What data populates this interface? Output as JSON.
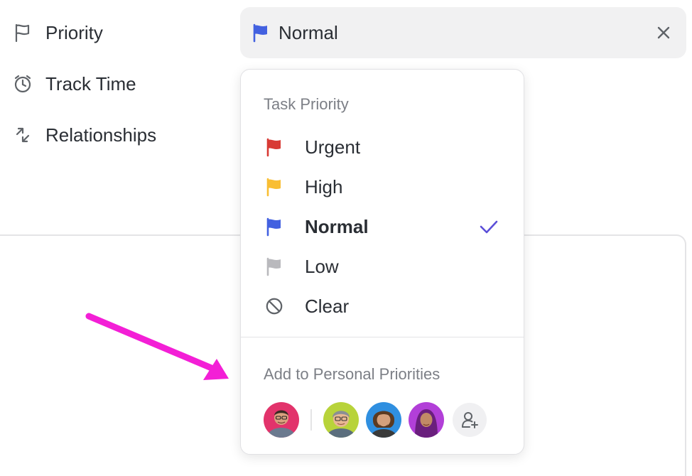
{
  "properties": {
    "priority": {
      "label": "Priority",
      "icon": "flag-outline-icon"
    },
    "track_time": {
      "label": "Track Time",
      "icon": "timer-icon"
    },
    "relationships": {
      "label": "Relationships",
      "icon": "relationships-icon"
    }
  },
  "priority_field": {
    "value": "Normal",
    "flag_color": "#4361e0",
    "clear_icon": "close-icon"
  },
  "dropdown": {
    "title": "Task Priority",
    "options": [
      {
        "label": "Urgent",
        "icon": "flag-icon",
        "color": "#d83a34"
      },
      {
        "label": "High",
        "icon": "flag-icon",
        "color": "#f9be33"
      },
      {
        "label": "Normal",
        "icon": "flag-icon",
        "color": "#4361e0",
        "selected": true
      },
      {
        "label": "Low",
        "icon": "flag-icon",
        "color": "#b9b9bd"
      },
      {
        "label": "Clear",
        "icon": "ban-icon",
        "color": "#5f6368"
      }
    ],
    "check_color": "#5b4fd8",
    "personal_title": "Add to Personal Priorities",
    "avatars": [
      {
        "name": "avatar-1",
        "bg": "#e2336b"
      },
      {
        "name": "avatar-2",
        "bg": "#b8d33a"
      },
      {
        "name": "avatar-3",
        "bg": "#2f8fe0"
      },
      {
        "name": "avatar-4",
        "bg": "#b23fd8"
      }
    ],
    "add_user_icon": "add-user-icon"
  },
  "annotation": {
    "arrow_color": "#f31fd6"
  }
}
